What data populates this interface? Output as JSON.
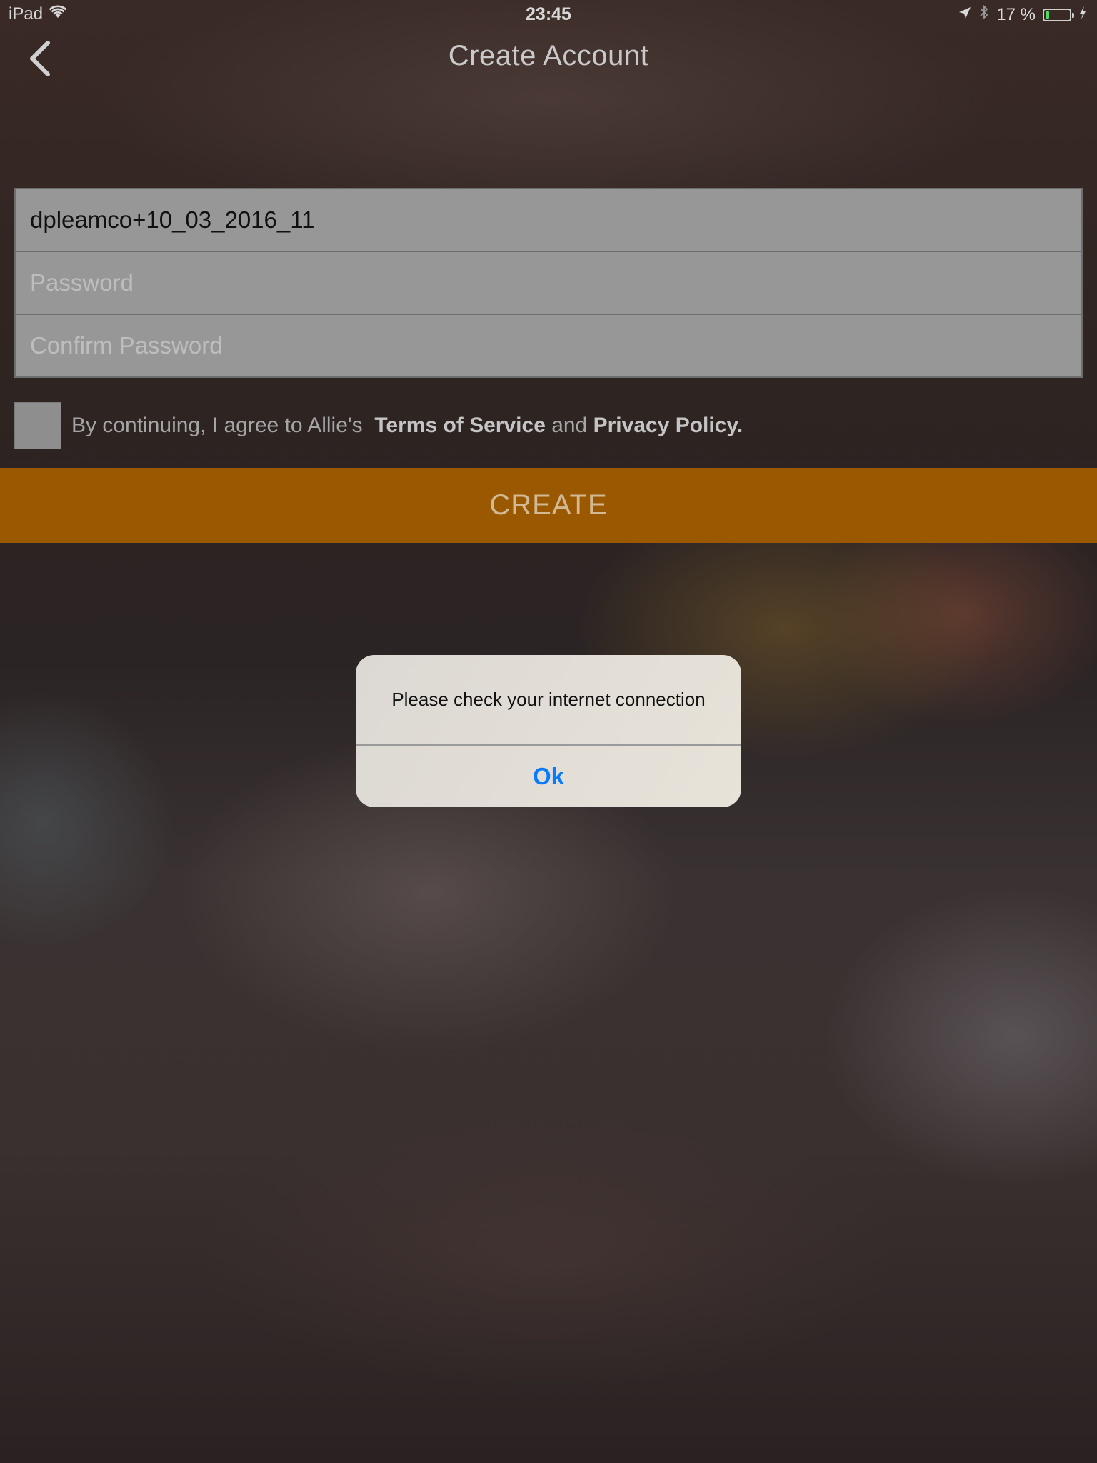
{
  "status_bar": {
    "device": "iPad",
    "time": "23:45",
    "battery_text": "17 %",
    "battery_level": 0.17,
    "battery_color": "#4cd964"
  },
  "nav": {
    "title": "Create Account",
    "back_icon": "chevron-left-icon"
  },
  "form": {
    "email_value": "dpleamco+10_03_2016_11",
    "password_placeholder": "Password",
    "confirm_password_placeholder": "Confirm Password"
  },
  "agreement": {
    "prefix": "By continuing, I agree to Allie's",
    "terms_link": "Terms of Service",
    "conjunction": "and",
    "privacy_link": "Privacy Policy."
  },
  "create_button": {
    "label": "CREATE",
    "color": "#9a5800"
  },
  "alert": {
    "message": "Please check your internet connection",
    "ok_label": "Ok",
    "ok_color": "#0a7aff"
  }
}
